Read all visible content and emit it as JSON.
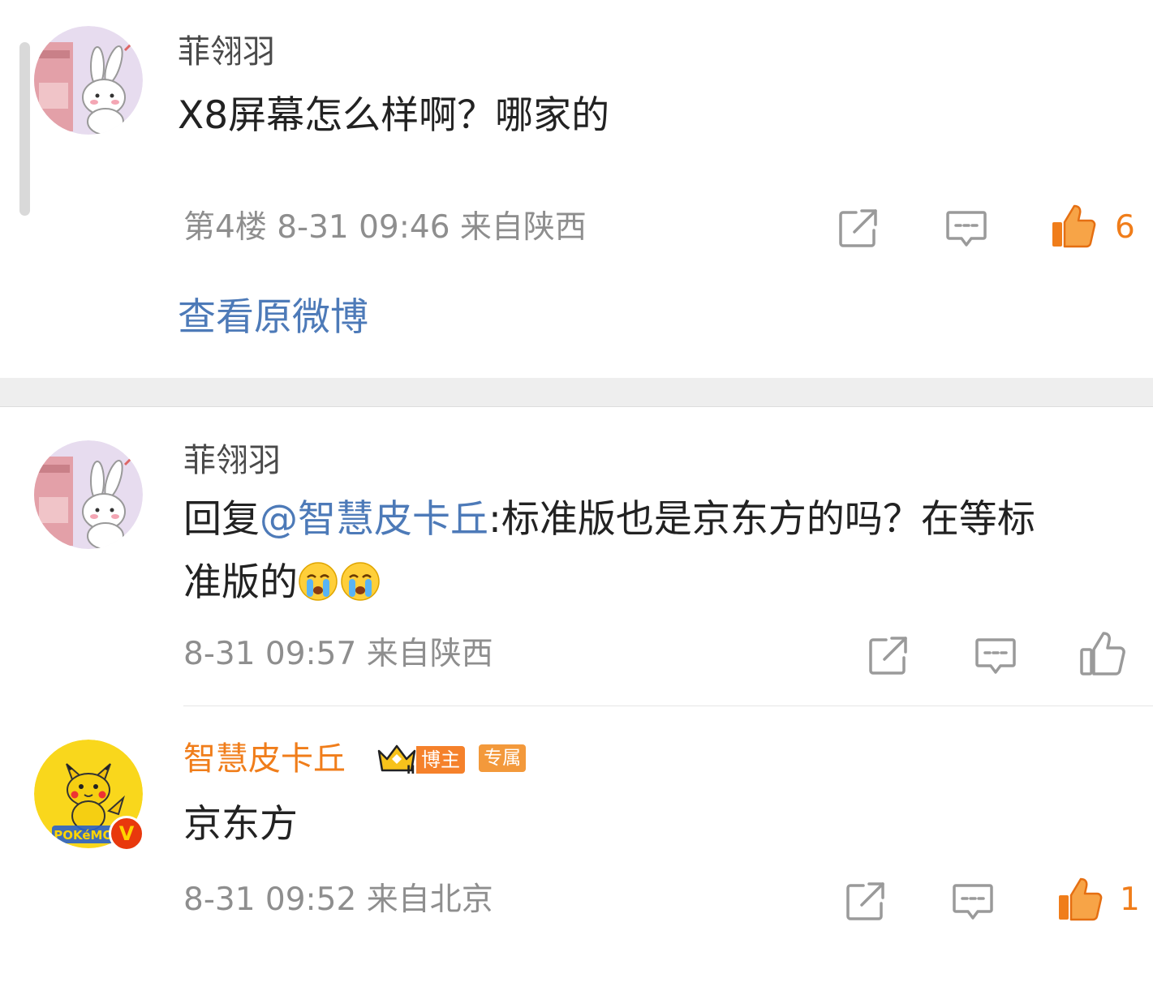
{
  "comments": [
    {
      "username": "菲翎羽",
      "text": "X8屏幕怎么样啊？哪家的",
      "meta": "第4楼  8-31 09:46  来自陕西",
      "likes": "6",
      "liked": true,
      "link": "查看原微博"
    },
    {
      "username": "菲翎羽",
      "reply_prefix": "回复",
      "mention": "@智慧皮卡丘",
      "text_line1": ":标准版也是京东方的吗？在等标",
      "text_line2": "准版的",
      "emoji": "crying-face",
      "meta": "8-31 09:57  来自陕西",
      "liked": false
    },
    {
      "username": "智慧皮卡丘",
      "badge_blogger": "博主",
      "badge_exclusive": "专属",
      "text": "京东方",
      "meta": "8-31 09:52  来自北京",
      "likes": "1",
      "liked": true,
      "avatar_text": "POKéMON",
      "verified_mark": "V"
    }
  ],
  "colors": {
    "accent_orange": "#f07d1a",
    "link_blue": "#4d7ab8",
    "meta_gray": "#8e8e8e"
  }
}
